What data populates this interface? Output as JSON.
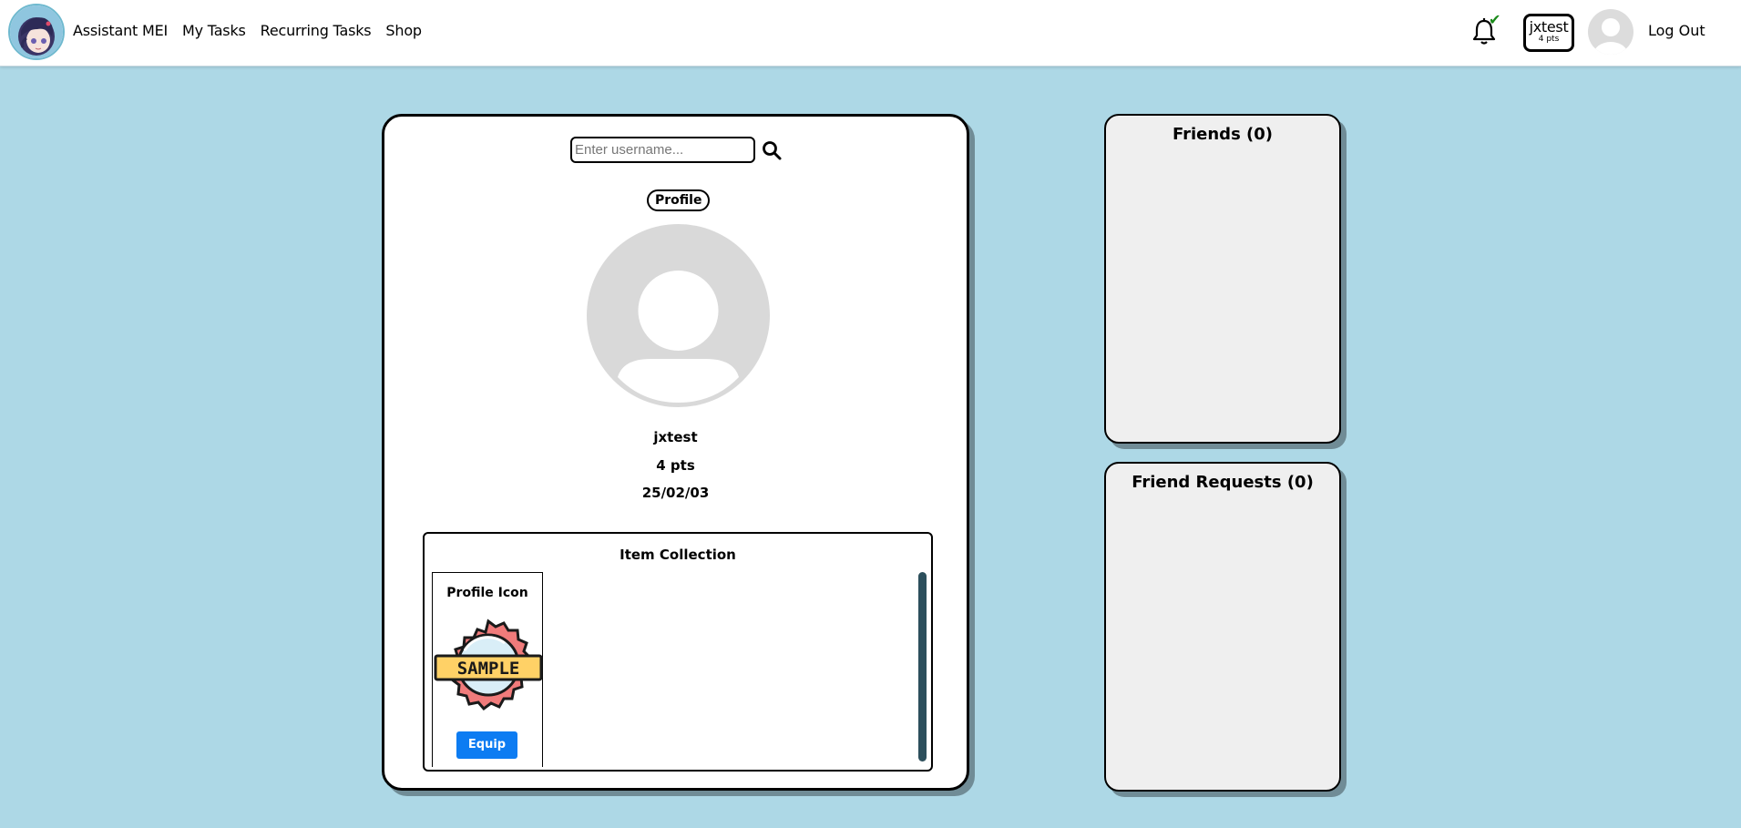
{
  "nav": {
    "app_name": "Assistant MEI",
    "links": [
      "My Tasks",
      "Recurring Tasks",
      "Shop"
    ],
    "notification_icon": "bell-icon",
    "notification_status_icon": "check-icon",
    "user_chip": {
      "username": "jxtest",
      "points": "4 pts"
    },
    "logout_label": "Log Out"
  },
  "search": {
    "placeholder": "Enter username...",
    "value": ""
  },
  "profile": {
    "tag_label": "Profile",
    "username": "jxtest",
    "points": "4 pts",
    "date": "25/02/03"
  },
  "collection": {
    "title": "Item Collection",
    "items": [
      {
        "name": "Profile Icon",
        "badge_text": "SAMPLE",
        "action_label": "Equip"
      }
    ]
  },
  "friends": {
    "title": "Friends (0)"
  },
  "friend_requests": {
    "title": "Friend Requests (0)"
  },
  "colors": {
    "page_bg": "#add8e6",
    "accent_button": "#0d7cf2",
    "panel_bg": "#efefef",
    "scrollbar": "#2c4f5c",
    "check_green": "#1a8a1a"
  }
}
